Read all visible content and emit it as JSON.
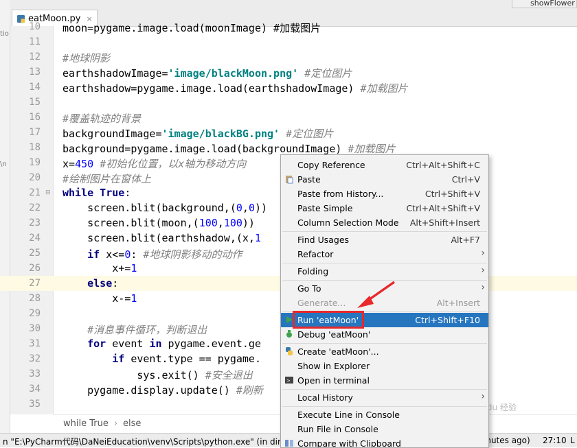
{
  "tabs": {
    "active": "eatMoon.py",
    "active_close": "×",
    "second": "showFlower"
  },
  "left_fragments": [
    "tio",
    "\\n"
  ],
  "code_lines": [
    {
      "n": "10",
      "html": "moon=pygame.image.load(moonImage) #加载图片"
    },
    {
      "n": "11",
      "html": ""
    },
    {
      "n": "12",
      "html": "<span class='cmt'>#地球阴影</span>"
    },
    {
      "n": "13",
      "html": "earthshadowImage=<span class='str'>'image/blackMoon.png'</span> <span class='cmt'>#定位图片</span>"
    },
    {
      "n": "14",
      "html": "earthshadow=pygame.image.load(earthshadowImage) <span class='cmt'>#加载图片</span>"
    },
    {
      "n": "15",
      "html": ""
    },
    {
      "n": "16",
      "html": "<span class='cmt'>#覆盖轨迹的背景</span>"
    },
    {
      "n": "17",
      "html": "backgroundImage=<span class='str'>'image/blackBG.png'</span> <span class='cmt'>#定位图片</span>"
    },
    {
      "n": "18",
      "html": "background=pygame.image.load(backgroundImage) <span class='cmt'>#加载图片</span>"
    },
    {
      "n": "19",
      "html": "x=<span class='num'>450</span> <span class='cmt'>#初始化位置，以x轴为移动方向</span>"
    },
    {
      "n": "20",
      "html": "<span class='cmt'>#绘制图片在窗体上</span>"
    },
    {
      "n": "21",
      "html": "<span class='kw'>while True</span>:"
    },
    {
      "n": "22",
      "html": "    screen.blit(background,(<span class='num'>0</span>,<span class='num'>0</span>))"
    },
    {
      "n": "23",
      "html": "    screen.blit(moon,(<span class='num'>100</span>,<span class='num'>100</span>))"
    },
    {
      "n": "24",
      "html": "    screen.blit(earthshadow,(x,<span class='num'>1</span>"
    },
    {
      "n": "25",
      "html": "    <span class='kw'>if</span> x&lt;=<span class='num'>0</span>: <span class='cmt'>#地球阴影移动的动作</span>"
    },
    {
      "n": "26",
      "html": "        x+=<span class='num'>1</span>"
    },
    {
      "n": "27",
      "html": "    <span class='kw'>else</span>:"
    },
    {
      "n": "28",
      "html": "        x-=<span class='num'>1</span>"
    },
    {
      "n": "29",
      "html": ""
    },
    {
      "n": "30",
      "html": "    <span class='cmt'>#消息事件循环，判断退出</span>"
    },
    {
      "n": "31",
      "html": "    <span class='kw'>for</span> event <span class='kw'>in</span> pygame.event.ge"
    },
    {
      "n": "32",
      "html": "        <span class='kw'>if</span> event.type == pygame."
    },
    {
      "n": "33",
      "html": "            sys.exit() <span class='cmt'>#安全退出</span>"
    },
    {
      "n": "34",
      "html": "    pygame.display.update() <span class='cmt'>#刷新</span>"
    },
    {
      "n": "35",
      "html": ""
    }
  ],
  "breadcrumb": [
    "while True",
    "else"
  ],
  "breadcrumb_sep": "›",
  "status": {
    "message": "n \"E:\\PyCharm代码\\DaNeiEducation\\venv\\Scripts\\python.exe\" (in directo",
    "tail": "inutes ago)",
    "position": "27:10",
    "line_sep": "L"
  },
  "context_menu": [
    {
      "label": "Copy Reference",
      "shortcut": "Ctrl+Alt+Shift+C"
    },
    {
      "label": "Paste",
      "shortcut": "Ctrl+V",
      "icon": "paste-icon"
    },
    {
      "label": "Paste from History...",
      "shortcut": "Ctrl+Shift+V"
    },
    {
      "label": "Paste Simple",
      "shortcut": "Ctrl+Alt+Shift+V"
    },
    {
      "label": "Column Selection Mode",
      "shortcut": "Alt+Shift+Insert"
    },
    {
      "sep": true
    },
    {
      "label": "Find Usages",
      "shortcut": "Alt+F7"
    },
    {
      "label": "Refactor",
      "submenu": true
    },
    {
      "sep": true
    },
    {
      "label": "Folding",
      "submenu": true
    },
    {
      "sep": true
    },
    {
      "label": "Go To",
      "submenu": true
    },
    {
      "label": "Generate...",
      "shortcut": "Alt+Insert",
      "disabled": true
    },
    {
      "sep": true
    },
    {
      "label": "Run 'eatMoon'",
      "shortcut": "Ctrl+Shift+F10",
      "icon": "run-icon",
      "selected": true
    },
    {
      "label": "Debug 'eatMoon'",
      "icon": "debug-icon"
    },
    {
      "sep": true
    },
    {
      "label": "Create 'eatMoon'...",
      "icon": "python-icon"
    },
    {
      "label": "Show in Explorer"
    },
    {
      "label": "Open in terminal",
      "icon": "terminal-icon"
    },
    {
      "sep": true
    },
    {
      "label": "Local History",
      "submenu": true
    },
    {
      "sep": true
    },
    {
      "label": "Execute Line in Console"
    },
    {
      "label": "Run File in Console"
    },
    {
      "label": "Compare with Clipboard",
      "icon": "compare-icon"
    }
  ],
  "submenu_arrow": "›",
  "watermark": "Baidu 经验",
  "colors": {
    "accent": "#2675bf",
    "highlight_box": "#e8282b",
    "current_line": "#fffae3"
  }
}
